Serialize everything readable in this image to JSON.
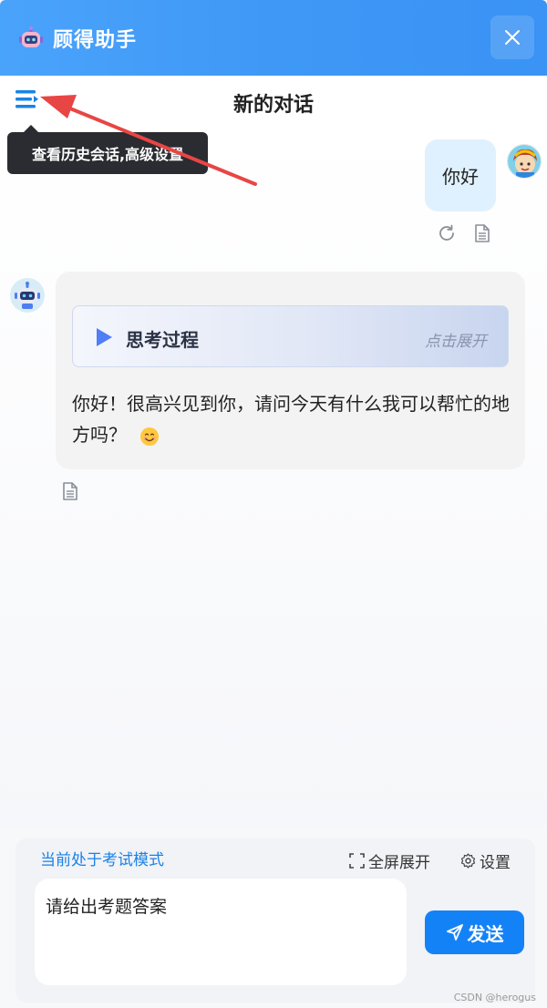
{
  "app": {
    "title": "顾得助手"
  },
  "conversation": {
    "title": "新的对话",
    "menu_tooltip": "查看历史会话,高级设置"
  },
  "messages": {
    "user": {
      "text": "你好"
    },
    "bot": {
      "thinking_label": "思考过程",
      "thinking_expand": "点击展开",
      "text": "你好！很高兴见到你，请问今天有什么我可以帮忙的地方吗？"
    }
  },
  "input": {
    "mode_label": "当前处于考试模式",
    "fullscreen_label": "全屏展开",
    "settings_label": "设置",
    "value": "请给出考题答案",
    "send_label": "发送"
  },
  "watermark": "CSDN @herogus",
  "colors": {
    "header_bg": "#3f98f5",
    "accent": "#1482f7",
    "tooltip_bg": "#2a2c31",
    "annotation_arrow": "#e84545"
  },
  "icons": {
    "menu": "menu-collapse-icon",
    "close": "close-icon",
    "regenerate": "refresh-icon",
    "copy": "document-icon",
    "fullscreen": "fullscreen-icon",
    "settings": "gear-icon",
    "send": "send-icon"
  }
}
